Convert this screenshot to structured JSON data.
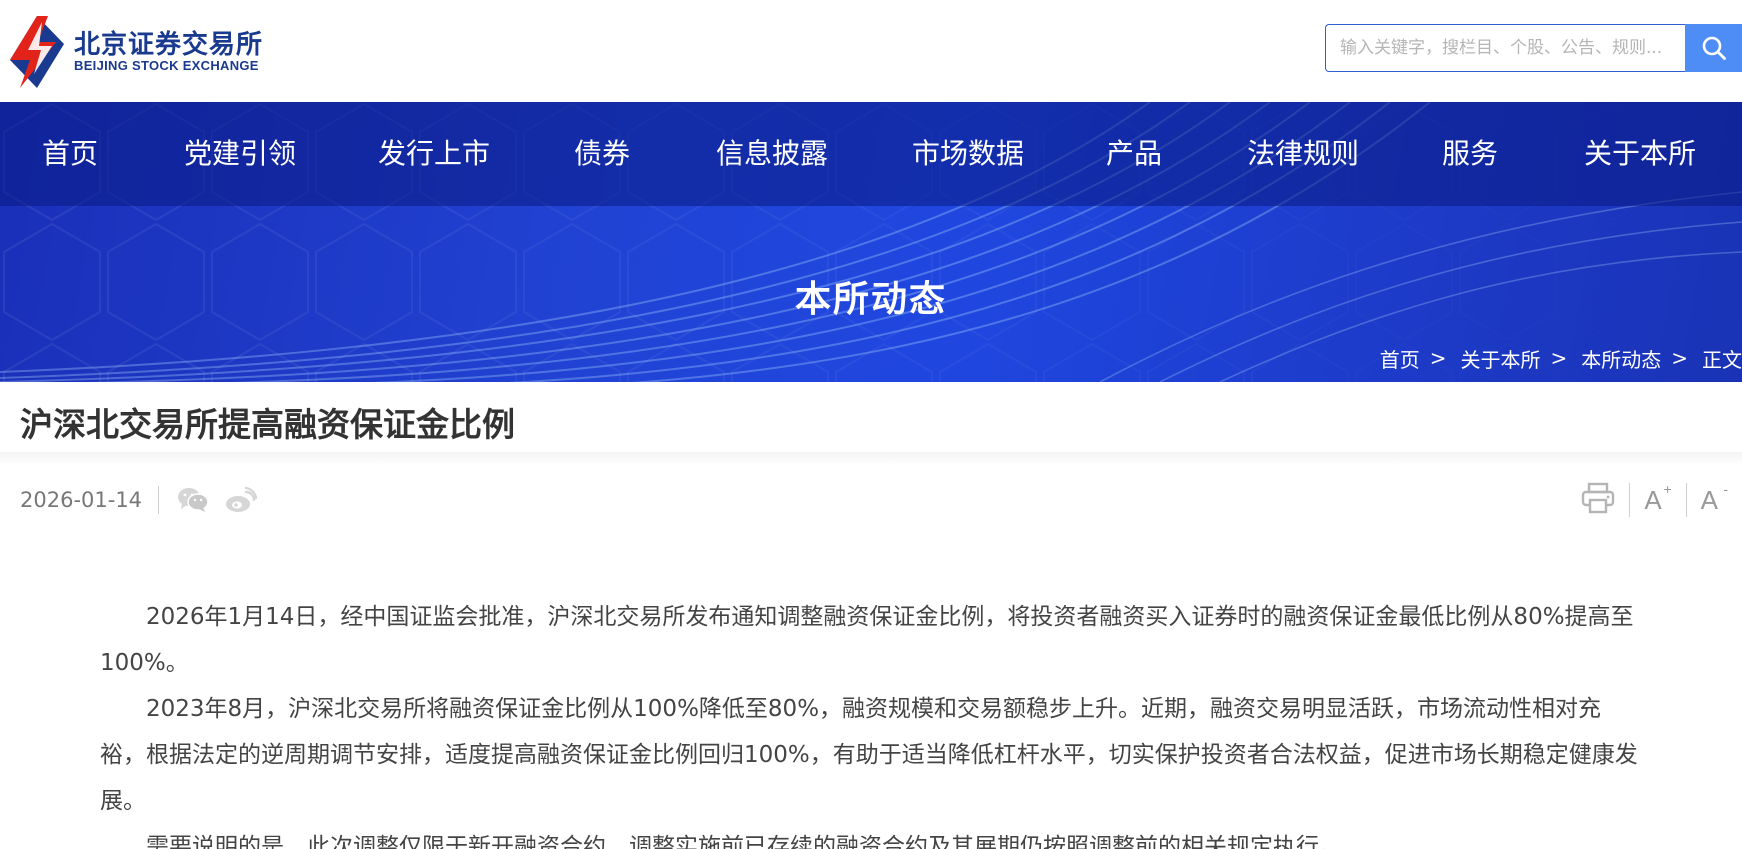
{
  "header": {
    "logo_cn": "北京证券交易所",
    "logo_en": "BEIJING STOCK EXCHANGE",
    "search_placeholder": "输入关键字，搜栏目、个股、公告、规则...",
    "search_icon": "search-icon"
  },
  "nav": {
    "items": [
      {
        "label": "首页"
      },
      {
        "label": "党建引领"
      },
      {
        "label": "发行上市"
      },
      {
        "label": "债券"
      },
      {
        "label": "信息披露"
      },
      {
        "label": "市场数据"
      },
      {
        "label": "产品"
      },
      {
        "label": "法律规则"
      },
      {
        "label": "服务"
      },
      {
        "label": "关于本所"
      }
    ]
  },
  "banner": {
    "title": "本所动态"
  },
  "breadcrumb": {
    "items": [
      "首页",
      "关于本所",
      "本所动态",
      "正文"
    ],
    "separator": ">"
  },
  "article": {
    "title": "沪深北交易所提高融资保证金比例",
    "date": "2026-01-14",
    "share_icons": [
      "wechat-icon",
      "weibo-icon"
    ],
    "tools": {
      "print_icon": "print-icon",
      "font_increase": "A",
      "font_increase_sup": "+",
      "font_decrease": "A",
      "font_decrease_sup": "-"
    },
    "paragraphs": [
      "2026年1月14日，经中国证监会批准，沪深北交易所发布通知调整融资保证金比例，将投资者融资买入证券时的融资保证金最低比例从80%提高至100%。",
      "2023年8月，沪深北交易所将融资保证金比例从100%降低至80%，融资规模和交易额稳步上升。近期，融资交易明显活跃，市场流动性相对充裕，根据法定的逆周期调节安排，适度提高融资保证金比例回归100%，有助于适当降低杠杆水平，切实保护投资者合法权益，促进市场长期稳定健康发展。",
      "需要说明的是，此次调整仅限于新开融资合约，调整实施前已存续的融资合约及其展期仍按照调整前的相关规定执行。"
    ]
  },
  "colors": {
    "brand_blue": "#1a3a8f",
    "logo_red": "#e2231a",
    "banner_blue": "#1f47e0",
    "search_button": "#4e8df5"
  }
}
